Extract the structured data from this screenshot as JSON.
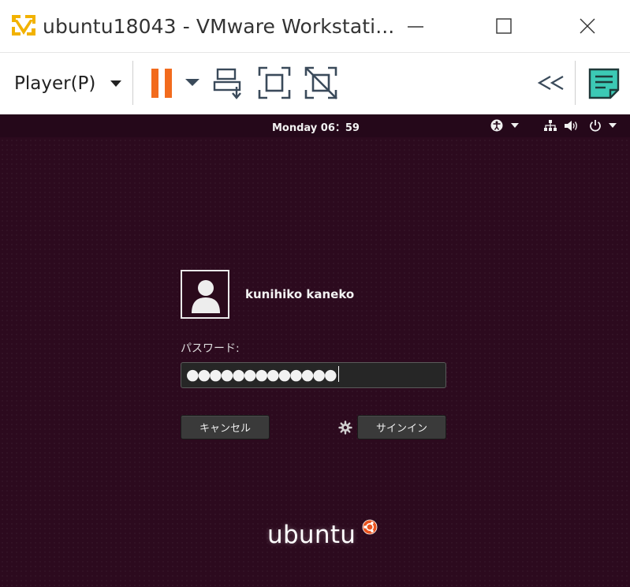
{
  "window": {
    "title": "ubuntu18043 - VMware Workstati..."
  },
  "toolbar": {
    "player_menu_label": "Player(P)"
  },
  "vm": {
    "topbar": {
      "clock": "Monday 06：59"
    },
    "login": {
      "user_name": "kunihiko kaneko",
      "password_label": "パスワード:",
      "password_value": "●●●●●●●●●●●●●",
      "cancel_label": "キャンセル",
      "signin_label": "サインイン"
    },
    "brand": {
      "wordmark": "ubuntu"
    }
  },
  "colors": {
    "pause_accent": "#f26b1d",
    "note_accent": "#3cc9b5",
    "logo_accent": "#f2b200",
    "desktop_bg": "#2c0a1e"
  },
  "icons": {
    "app_logo": "vmware-logo-icon",
    "pause": "pause-icon",
    "send_ctrl_alt_del": "send-ctrl-alt-del-icon",
    "fullscreen": "fullscreen-icon",
    "unity": "unity-mode-icon",
    "collapse": "double-chevron-left-icon",
    "notes": "notes-icon",
    "accessibility": "accessibility-icon",
    "network": "network-icon",
    "volume": "volume-icon",
    "power": "power-icon",
    "gear": "gear-icon"
  }
}
